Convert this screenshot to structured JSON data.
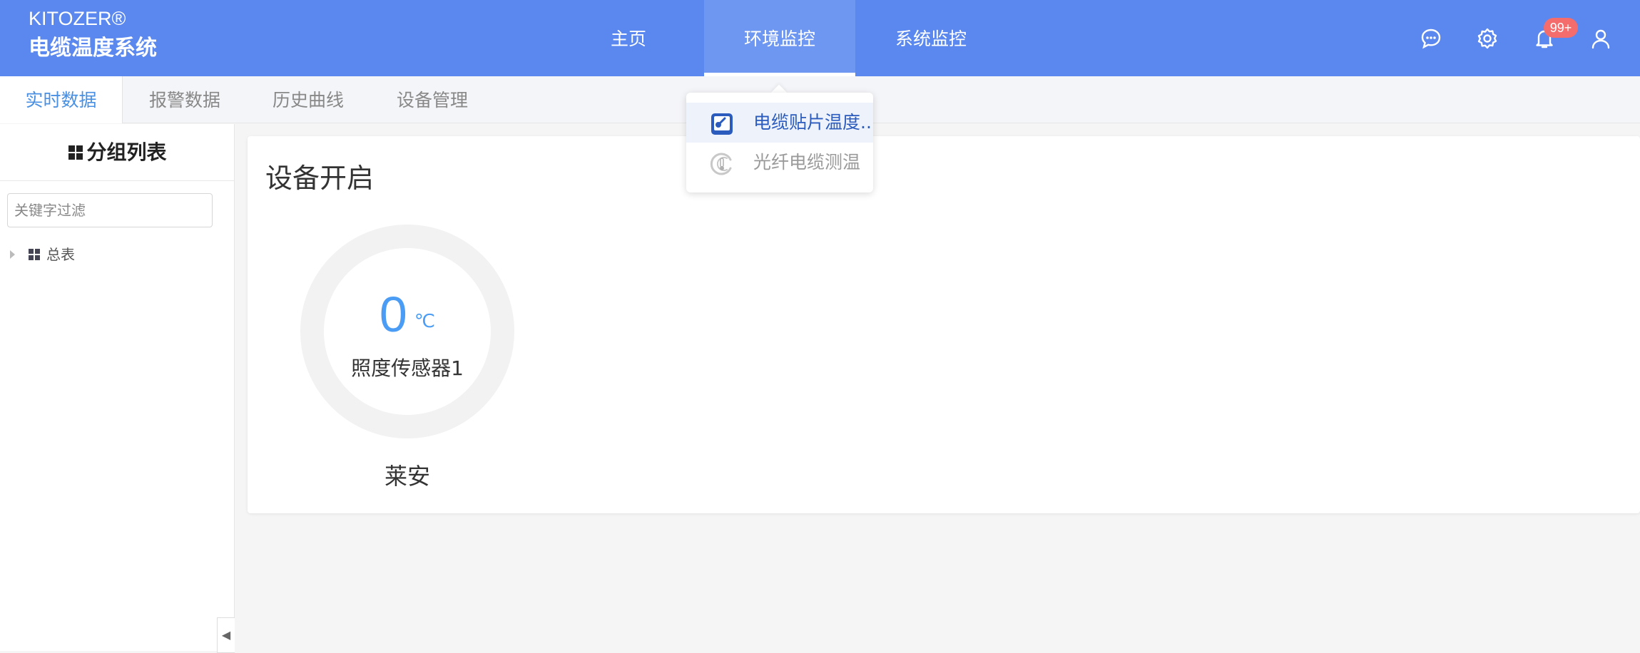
{
  "brand": {
    "en": "KITOZER®",
    "cn": "电缆温度系统"
  },
  "nav": {
    "items": [
      "主页",
      "环境监控",
      "系统监控"
    ],
    "active": "环境监控"
  },
  "header_icons": [
    "chat-icon",
    "gear-icon",
    "bell-icon",
    "user-icon"
  ],
  "notifications": {
    "badge": "99+"
  },
  "subtabs": {
    "items": [
      "实时数据",
      "报警数据",
      "历史曲线",
      "设备管理"
    ],
    "active": "实时数据"
  },
  "dropdown": {
    "items": [
      "电缆贴片温度...",
      "光纤电缆测温"
    ]
  },
  "sidebar": {
    "title": "分组列表",
    "search_placeholder": "关键字过滤",
    "tree": [
      {
        "label": "总表"
      }
    ]
  },
  "card": {
    "title": "设备开启",
    "gauge": {
      "value": "0",
      "unit": "℃",
      "sensor": "照度传感器1"
    },
    "device": "莱安"
  },
  "colors": {
    "header": "#5b88ee",
    "accent": "#4a9cf4",
    "badge": "#f56c6c"
  }
}
